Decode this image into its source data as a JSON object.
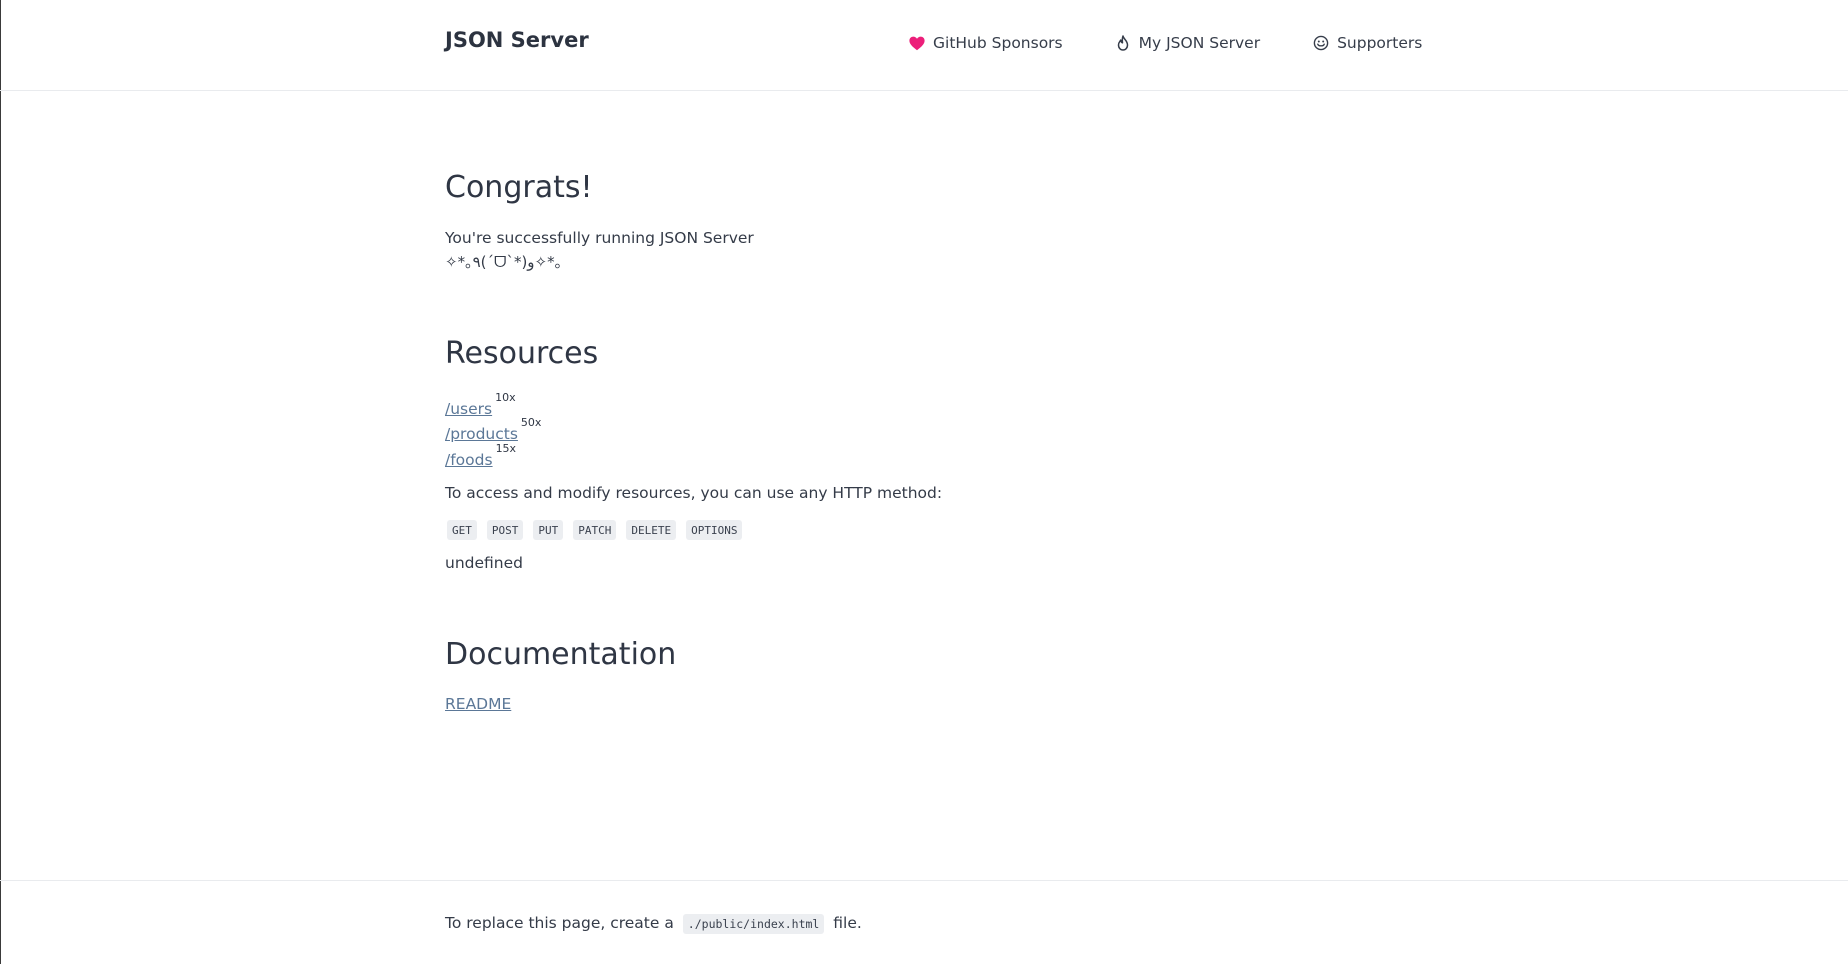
{
  "header": {
    "brand": "JSON Server",
    "nav": [
      {
        "label": "GitHub Sponsors",
        "icon": "heart-icon",
        "icon_color": "#ec1f7a"
      },
      {
        "label": "My JSON Server",
        "icon": "flame-icon"
      },
      {
        "label": "Supporters",
        "icon": "smiley-icon"
      }
    ]
  },
  "main": {
    "congrats_title": "Congrats!",
    "success_text": "You're successfully running JSON Server",
    "kaomoji": "✧*｡٩(ˊᗜˋ*)و✧*｡",
    "resources_title": "Resources",
    "resources": [
      {
        "path": "/users",
        "count": "10x"
      },
      {
        "path": "/products",
        "count": "50x"
      },
      {
        "path": "/foods",
        "count": "15x"
      }
    ],
    "access_text": "To access and modify resources, you can use any HTTP method:",
    "methods": [
      "GET",
      "POST",
      "PUT",
      "PATCH",
      "DELETE",
      "OPTIONS"
    ],
    "undefined_text": "undefined",
    "documentation_title": "Documentation",
    "readme_label": "README"
  },
  "footer": {
    "text_before": "To replace this page, create a",
    "code": "./public/index.html",
    "text_after": "file."
  },
  "colors": {
    "text": "#313744",
    "link": "#5b7797",
    "code_bg": "#eceef1",
    "border": "#e9ebee"
  }
}
